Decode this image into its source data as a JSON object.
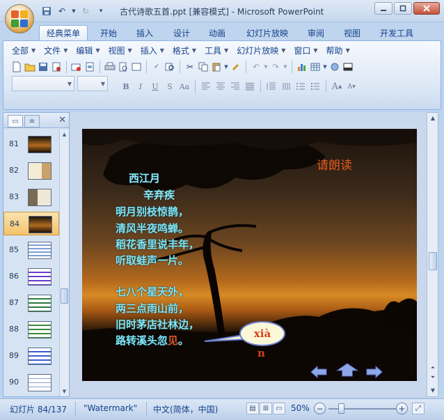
{
  "titlebar": {
    "title": "古代诗歌五首.ppt [兼容模式] - Microsoft PowerPoint",
    "qat_icons": [
      "save-icon",
      "undo-icon",
      "redo-icon",
      "customize-icon"
    ],
    "window_buttons": [
      "minimize",
      "restore",
      "close"
    ]
  },
  "ribbon_tabs": [
    "经典菜单",
    "开始",
    "插入",
    "设计",
    "动画",
    "幻灯片放映",
    "审阅",
    "视图",
    "开发工具"
  ],
  "active_tab": "经典菜单",
  "menu_items": [
    "全部",
    "文件",
    "编辑",
    "视图",
    "插入",
    "格式",
    "工具",
    "幻灯片放映",
    "窗口",
    "帮助"
  ],
  "format_buttons": [
    "B",
    "I",
    "U",
    "S",
    "Aa"
  ],
  "left_pane": {
    "slides": [
      {
        "num": "81"
      },
      {
        "num": "82"
      },
      {
        "num": "83"
      },
      {
        "num": "84",
        "selected": true
      },
      {
        "num": "85"
      },
      {
        "num": "86"
      },
      {
        "num": "87"
      },
      {
        "num": "88"
      },
      {
        "num": "89"
      },
      {
        "num": "90"
      }
    ]
  },
  "slide": {
    "poem_title": "西江月",
    "poem_author": "辛弃疾",
    "stanza1": [
      "明月别枝惊鹊，",
      "清风半夜鸣蝉。",
      "稻花香里说丰年，",
      "听取蛙声一片。"
    ],
    "stanza2": [
      "七八个星天外，",
      "两三点雨山前，",
      "旧时茅店社林边，"
    ],
    "last_line_prefix": "路转溪头忽",
    "last_line_red": "见",
    "last_line_suffix": "。",
    "read_aloud": "请朗读",
    "pinyin_bubble": "xià",
    "pinyin_tail": "n"
  },
  "statusbar": {
    "slide_info": "幻灯片 84/137",
    "theme": "\"Watermark\"",
    "language": "中文(简体，中国)",
    "zoom": "50%",
    "zoom_minus": "−",
    "zoom_plus": "+"
  },
  "colors": {
    "poem_text": "#7fe5f5",
    "accent_orange": "#e65a1d",
    "selected_thumb": "#f4c36a"
  }
}
